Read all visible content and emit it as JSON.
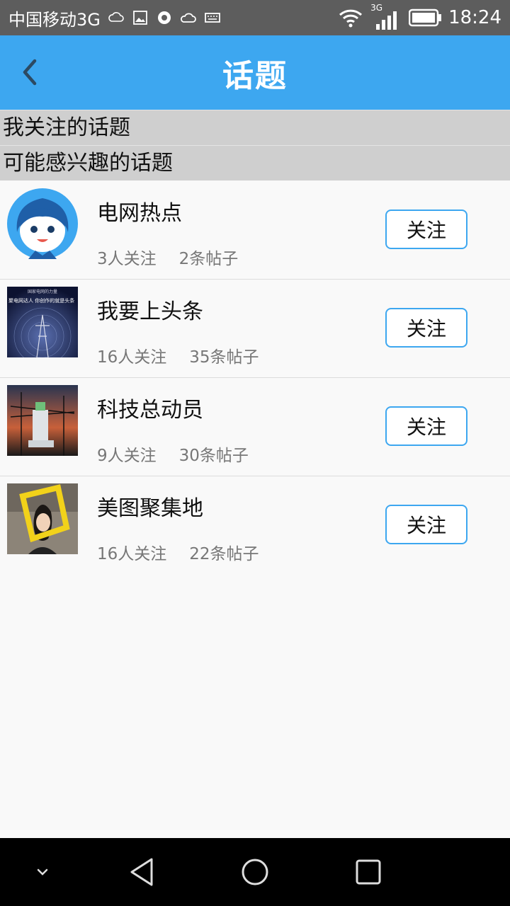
{
  "status_bar": {
    "carrier": "中国移动3G",
    "network": "3G",
    "time": "18:24"
  },
  "app_bar": {
    "title": "话题"
  },
  "sections": {
    "followed": "我关注的话题",
    "interested": "可能感兴趣的话题"
  },
  "topics": [
    {
      "name": "电网热点",
      "followers": "3人关注",
      "posts": "2条帖子",
      "button": "关注"
    },
    {
      "name": "我要上头条",
      "followers": "16人关注",
      "posts": "35条帖子",
      "button": "关注"
    },
    {
      "name": "科技总动员",
      "followers": "9人关注",
      "posts": "30条帖子",
      "button": "关注"
    },
    {
      "name": "美图聚集地",
      "followers": "16人关注",
      "posts": "22条帖子",
      "button": "关注"
    }
  ],
  "thumbs": {
    "t2_line1": "国家电网的力量",
    "t2_line2": "聚电网达人 你创作的就是头条"
  },
  "colors": {
    "app_bar": "#3da7f0",
    "status_bar": "#5d5d5d",
    "section_header": "#cfcfcf",
    "button_border": "#3da7f0"
  }
}
